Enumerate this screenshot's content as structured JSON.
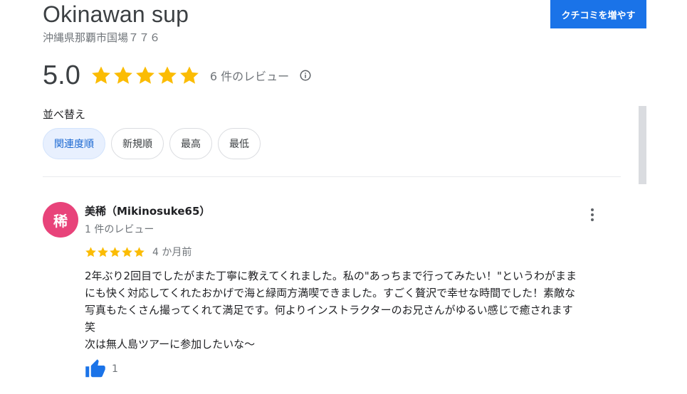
{
  "place": {
    "title": "Okinawan sup",
    "address": "沖縄県那覇市国場７７６"
  },
  "header": {
    "add_review_label": "クチコミを増やす"
  },
  "rating": {
    "value": "5.0",
    "stars": 5,
    "review_count": "6 件のレビュー"
  },
  "sort": {
    "label": "並べ替え",
    "options": [
      "関連度順",
      "新規順",
      "最高",
      "最低"
    ],
    "selected": "関連度順"
  },
  "review": {
    "avatar_letter": "稀",
    "avatar_color": "#e8437a",
    "name": "美稀（Mikinosuke65）",
    "meta": "1 件のレビュー",
    "stars": 5,
    "date": "4 か月前",
    "text_line1": "2年ぶり2回目でしたがまた丁寧に教えてくれました。私の\"あっちまで行ってみたい！\"というわがまま",
    "text_line2": "にも快く対応してくれたおかげで海と緑両方満喫できました。すごく贅沢で幸せな時間でした！素敵な",
    "text_line3": "写真もたくさん撮ってくれて満足です。何よりインストラクターのお兄さんがゆるい感じで癒されます",
    "text_line4": "笑",
    "text_line5": "次は無人島ツアーに参加したいな〜",
    "likes": "1"
  },
  "colors": {
    "accent": "#1a73e8",
    "star": "#fbbc04",
    "chip_selected_bg": "#e8f0fe"
  },
  "icons": [
    "star-icon",
    "info-icon",
    "more-vert-icon",
    "thumb-up-icon"
  ]
}
